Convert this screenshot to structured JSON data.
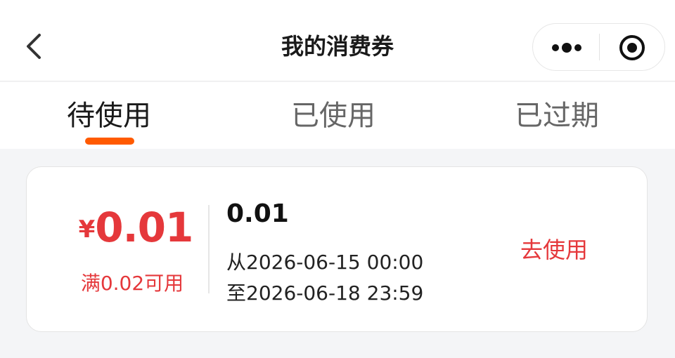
{
  "navbar": {
    "title": "我的消费券",
    "back_icon": "chevron-left-icon",
    "more_icon": "more-dots-icon",
    "close_icon": "mini-program-close-icon"
  },
  "tabs": [
    {
      "label": "待使用",
      "active": true
    },
    {
      "label": "已使用",
      "active": false
    },
    {
      "label": "已过期",
      "active": false
    }
  ],
  "colors": {
    "accent": "#ff5a00",
    "price_red": "#e5383b",
    "page_bg": "#f4f5f7"
  },
  "coupons": [
    {
      "currency_symbol": "¥",
      "amount": "0.01",
      "threshold": "满0.02可用",
      "name": "0.01",
      "valid_from": "从2026-06-15 00:00",
      "valid_to": "至2026-06-18 23:59",
      "action_label": "去使用"
    }
  ]
}
